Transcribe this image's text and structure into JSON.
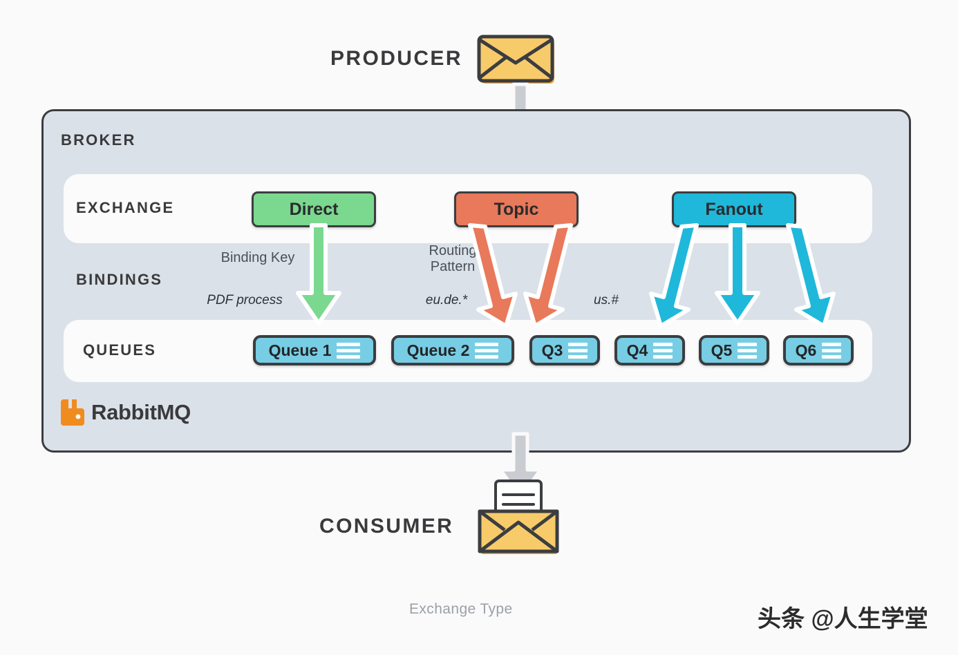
{
  "diagram": {
    "caption": "Exchange Type",
    "watermark": "头条 @人生学堂"
  },
  "producer": {
    "label": "PRODUCER",
    "icon": "envelope-closed-icon"
  },
  "consumer": {
    "label": "CONSUMER",
    "icon": "envelope-open-document-icon"
  },
  "broker": {
    "label": "BROKER",
    "brand": "RabbitMQ",
    "brand_icon": "rabbitmq-logo-icon",
    "rows": {
      "exchange_label": "EXCHANGE",
      "bindings_label": "BINDINGS",
      "queues_label": "QUEUES"
    },
    "exchanges": [
      {
        "name": "Direct",
        "color": "#7bd88f"
      },
      {
        "name": "Topic",
        "color": "#e8795a"
      },
      {
        "name": "Fanout",
        "color": "#1fb8da"
      }
    ],
    "bindings": [
      {
        "title": "Binding Key",
        "key": "PDF process"
      },
      {
        "title": "Routing Pattern",
        "key": "eu.de.*"
      },
      {
        "title": "",
        "key": "us.#"
      }
    ],
    "queues": [
      {
        "label": "Queue 1"
      },
      {
        "label": "Queue 2"
      },
      {
        "label": "Q3"
      },
      {
        "label": "Q4"
      },
      {
        "label": "Q5"
      },
      {
        "label": "Q6"
      }
    ]
  },
  "colors": {
    "background": "#fbfafb",
    "broker_fill": "#dbe1e9",
    "broker_border": "#3b3d40",
    "panel_fill": "#fbfbfc",
    "direct_green": "#7bd88f",
    "topic_orange": "#e8795a",
    "fanout_cyan": "#1fb8da",
    "queue_blue": "#77cde4",
    "arrow_gray": "#c9ccd1",
    "envelope_orange": "#f5bd4f",
    "rabbit_orange": "#f08c1e",
    "caption_gray": "#9aa0a6"
  }
}
